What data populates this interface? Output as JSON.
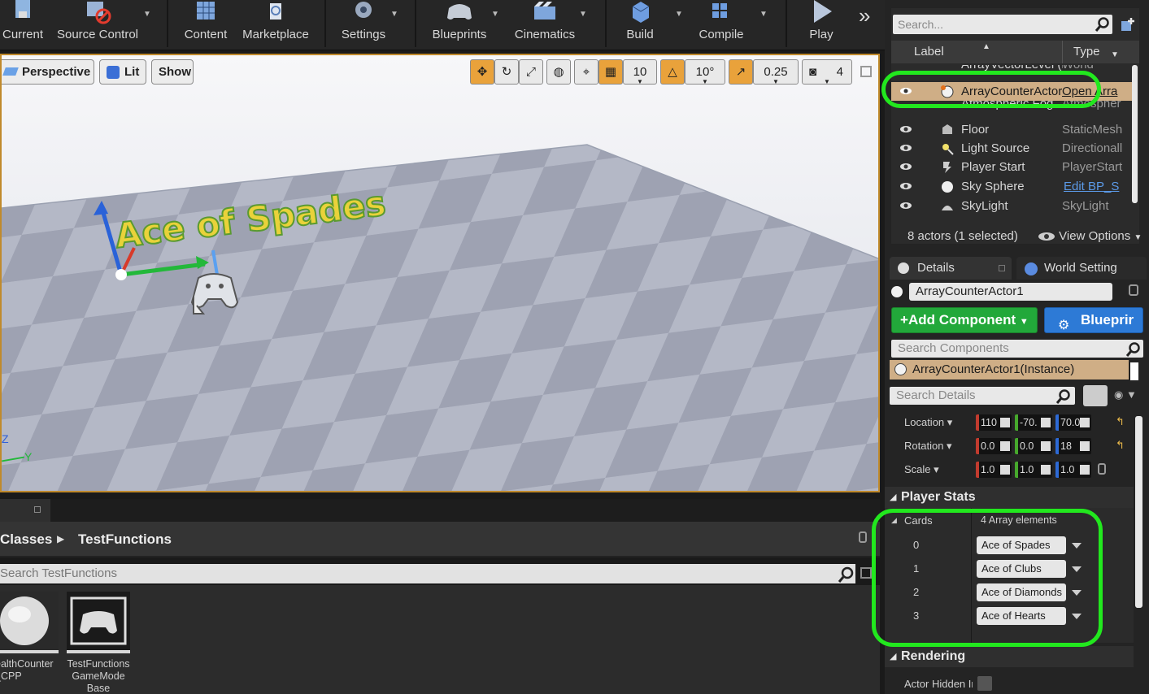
{
  "toolbar": {
    "items": [
      {
        "label": "Current",
        "icon": "save-current-icon"
      },
      {
        "label": "Source Control",
        "icon": "source-control-icon"
      },
      {
        "label": "Content",
        "icon": "content-icon"
      },
      {
        "label": "Marketplace",
        "icon": "marketplace-icon"
      },
      {
        "label": "Settings",
        "icon": "settings-icon"
      },
      {
        "label": "Blueprints",
        "icon": "blueprints-icon"
      },
      {
        "label": "Cinematics",
        "icon": "cinematics-icon"
      },
      {
        "label": "Build",
        "icon": "build-icon"
      },
      {
        "label": "Compile",
        "icon": "compile-icon"
      },
      {
        "label": "Play",
        "icon": "play-icon"
      }
    ],
    "overflow": "»"
  },
  "viewport": {
    "perspective": "Perspective",
    "lit": "Lit",
    "show": "Show",
    "grid_snap": "10",
    "rotation_snap": "10°",
    "scale_snap": "0.25",
    "camera_speed": "4",
    "world_text": "Ace of Spades",
    "axis_z": "Z",
    "axis_y": "Y"
  },
  "content_browser": {
    "path_parent": "Classes",
    "path_current": "TestFunctions",
    "search_placeholder": "Search TestFunctions",
    "assets": [
      {
        "name": "ealthCounter\n_CPP"
      },
      {
        "name": "TestFunctions\nGameMode\nBase"
      }
    ]
  },
  "outliner": {
    "search_placeholder": "Search...",
    "col_label": "Label",
    "col_type": "Type",
    "rows": [
      {
        "label": "ArrayVectorLevel (Editor)",
        "type": "World",
        "selected": false
      },
      {
        "label": "ArrayCounterActor1",
        "type": "Open Arra",
        "selected": true
      },
      {
        "label": "Atmospheric Fog",
        "type": "Atmospher",
        "selected": false
      },
      {
        "label": "Floor",
        "type": "StaticMesh",
        "selected": false
      },
      {
        "label": "Light Source",
        "type": "Directionall",
        "selected": false
      },
      {
        "label": "Player Start",
        "type": "PlayerStart",
        "selected": false
      },
      {
        "label": "Sky Sphere",
        "type": "Edit BP_S",
        "selected": false
      },
      {
        "label": "SkyLight",
        "type": "SkyLight",
        "selected": false
      }
    ],
    "status": "8 actors (1 selected)",
    "view_options": "View Options"
  },
  "details": {
    "tab_details": "Details",
    "tab_world": "World Setting",
    "actor_name": "ArrayCounterActor1",
    "add_component": "Add Component",
    "blueprint": "Blueprir",
    "search_components": "Search Components",
    "instance": "ArrayCounterActor1(Instance)",
    "search_details": "Search Details",
    "transform": {
      "location_label": "Location",
      "rotation_label": "Rotation",
      "scale_label": "Scale",
      "location": [
        "110",
        "-70.",
        "70.0"
      ],
      "rotation": [
        "0.0",
        "0.0",
        "18"
      ],
      "scale": [
        "1.0",
        "1.0",
        "1.0"
      ]
    },
    "player_stats": {
      "title": "Player Stats",
      "cards_label": "Cards",
      "cards_summary": "4 Array elements",
      "cards": [
        {
          "index": "0",
          "value": "Ace of Spades"
        },
        {
          "index": "1",
          "value": "Ace of Clubs"
        },
        {
          "index": "2",
          "value": "Ace of Diamonds"
        },
        {
          "index": "3",
          "value": "Ace of Hearts"
        }
      ]
    },
    "rendering": {
      "title": "Rendering",
      "actor_hidden": "Actor Hidden Ir"
    }
  },
  "colors": {
    "highlight": "#22e81e",
    "selection": "#cfae86",
    "accent_orange": "#e9a23b",
    "add_component_green": "#22a83a",
    "blueprint_blue": "#2d7ad6"
  }
}
